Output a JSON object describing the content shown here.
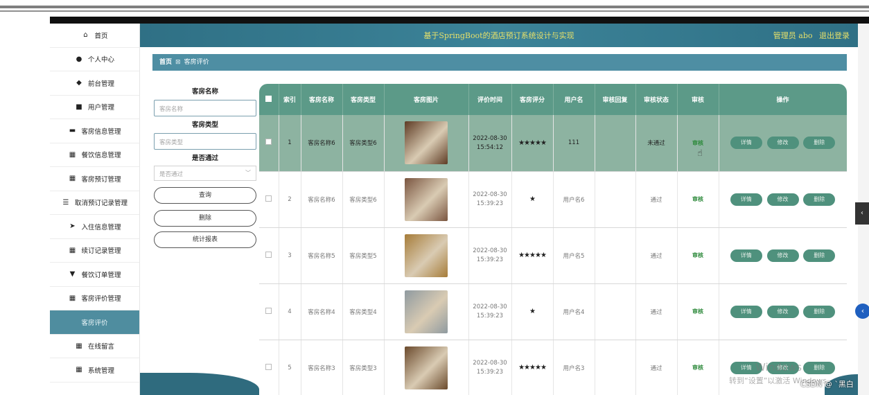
{
  "header": {
    "title": "基于SpringBoot的酒店预订系统设计与实现",
    "user_label": "管理员 abo",
    "logout": "退出登录"
  },
  "sidebar": {
    "items": [
      {
        "label": "首页",
        "icon": "home-icon",
        "glyph": "⌂"
      },
      {
        "label": "个人中心",
        "icon": "user-icon",
        "glyph": "●"
      },
      {
        "label": "前台管理",
        "icon": "pin-icon",
        "glyph": "◆"
      },
      {
        "label": "用户管理",
        "icon": "card-icon",
        "glyph": "■"
      },
      {
        "label": "客房信息管理",
        "icon": "chat-icon",
        "glyph": "▬"
      },
      {
        "label": "餐饮信息管理",
        "icon": "grid-icon",
        "glyph": "▦"
      },
      {
        "label": "客房预订管理",
        "icon": "grid-icon",
        "glyph": "▦"
      },
      {
        "label": "取消预订记录管理",
        "icon": "sliders-icon",
        "glyph": "☰"
      },
      {
        "label": "入住信息管理",
        "icon": "send-icon",
        "glyph": "➤"
      },
      {
        "label": "续订记录管理",
        "icon": "grid-icon",
        "glyph": "▦"
      },
      {
        "label": "餐饮订单管理",
        "icon": "shield-icon",
        "glyph": "▼"
      },
      {
        "label": "客房评价管理",
        "icon": "grid-icon",
        "glyph": "▦"
      },
      {
        "label": "客房评价",
        "icon": "",
        "glyph": ""
      },
      {
        "label": "在线留言",
        "icon": "grid-icon",
        "glyph": "▦"
      },
      {
        "label": "系统管理",
        "icon": "grid-icon",
        "glyph": "▦"
      }
    ]
  },
  "breadcrumb": {
    "home": "首页",
    "current": "客房评价"
  },
  "search": {
    "room_name_label": "客房名称",
    "room_name_placeholder": "客房名称",
    "room_type_label": "客房类型",
    "room_type_placeholder": "客房类型",
    "pass_label": "是否通过",
    "pass_placeholder": "是否通过",
    "query": "查询",
    "delete": "删除",
    "report": "统计报表"
  },
  "table": {
    "headers": [
      "索引",
      "客房名称",
      "客房类型",
      "客房图片",
      "评价时间",
      "客房评分",
      "用户名",
      "审核回复",
      "审核状态",
      "审核",
      "操作"
    ],
    "rows": [
      {
        "idx": "1",
        "name": "客房名称6",
        "type": "客房类型6",
        "date": "2022-08-30",
        "time": "15:54:12",
        "stars": "★★★★★",
        "user": "111",
        "reply": "",
        "status": "未通过",
        "audit": "审核",
        "photo": "#5e3b24"
      },
      {
        "idx": "2",
        "name": "客房名称6",
        "type": "客房类型6",
        "date": "2022-08-30",
        "time": "15:39:23",
        "stars": "★",
        "user": "用户名6",
        "reply": "",
        "status": "通过",
        "audit": "审核",
        "photo": "#7a5540"
      },
      {
        "idx": "3",
        "name": "客房名称5",
        "type": "客房类型5",
        "date": "2022-08-30",
        "time": "15:39:23",
        "stars": "★★★★★",
        "user": "用户名5",
        "reply": "",
        "status": "通过",
        "audit": "审核",
        "photo": "#a67c39"
      },
      {
        "idx": "4",
        "name": "客房名称4",
        "type": "客房类型4",
        "date": "2022-08-30",
        "time": "15:39:23",
        "stars": "★",
        "user": "用户名4",
        "reply": "",
        "status": "通过",
        "audit": "审核",
        "photo": "#8f9aa0"
      },
      {
        "idx": "5",
        "name": "客房名称3",
        "type": "客房类型3",
        "date": "2022-08-30",
        "time": "15:39:23",
        "stars": "★★★★★",
        "user": "用户名3",
        "reply": "",
        "status": "通过",
        "audit": "审核",
        "photo": "#6b4a2c"
      }
    ],
    "actions": {
      "detail": "详情",
      "edit": "修改",
      "delete": "删除"
    }
  },
  "watermark": {
    "line1": "Windows",
    "line2": "转到“设置”以激活 Windows。",
    "csdn": "CSDN @ `黑白"
  }
}
